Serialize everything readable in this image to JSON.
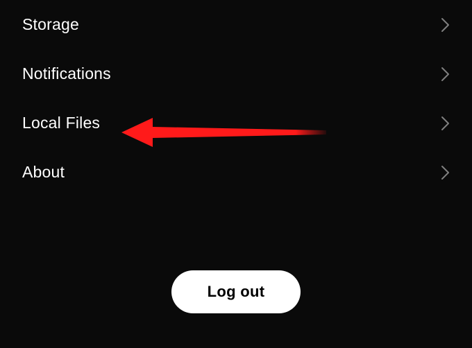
{
  "settings": {
    "items": [
      {
        "label": "Storage"
      },
      {
        "label": "Notifications"
      },
      {
        "label": "Local Files"
      },
      {
        "label": "About"
      }
    ]
  },
  "logout": {
    "label": "Log out"
  },
  "annotation": {
    "arrow_color": "#ff1a1a"
  }
}
